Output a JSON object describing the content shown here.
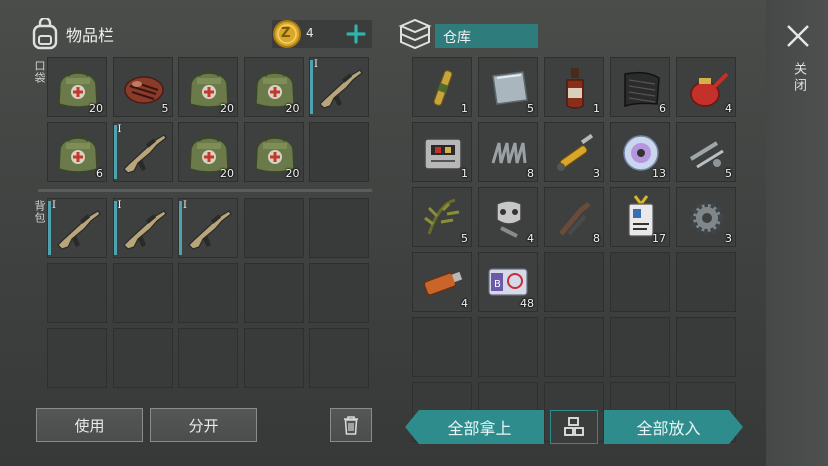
{
  "inventory": {
    "title": "物品栏",
    "pocket_label": "口袋",
    "backpack_label": "背包",
    "coins": {
      "count": "4",
      "symbol": "Z"
    },
    "pocket_slots": [
      {
        "item": "medkit-bag",
        "count": "20"
      },
      {
        "item": "steak",
        "count": "5"
      },
      {
        "item": "medkit-bag",
        "count": "20"
      },
      {
        "item": "medkit-bag",
        "count": "20"
      },
      {
        "item": "rifle",
        "tier": "I"
      },
      {
        "item": "medkit-bag",
        "count": "6"
      },
      {
        "item": "rifle",
        "tier": "I"
      },
      {
        "item": "medkit-bag",
        "count": "20"
      },
      {
        "item": "medkit-bag",
        "count": "20"
      },
      {
        "item": ""
      }
    ],
    "backpack_slots": [
      {
        "item": "rifle",
        "tier": "I"
      },
      {
        "item": "rifle",
        "tier": "I"
      },
      {
        "item": "rifle",
        "tier": "I"
      },
      {
        "item": ""
      },
      {
        "item": ""
      },
      {
        "item": ""
      },
      {
        "item": ""
      },
      {
        "item": ""
      },
      {
        "item": ""
      },
      {
        "item": ""
      },
      {
        "item": ""
      },
      {
        "item": ""
      },
      {
        "item": ""
      },
      {
        "item": ""
      },
      {
        "item": ""
      }
    ]
  },
  "storage": {
    "title": "仓库",
    "slots": [
      {
        "item": "ampoule",
        "count": "1"
      },
      {
        "item": "metal-plate",
        "count": "5"
      },
      {
        "item": "bottle",
        "count": "1"
      },
      {
        "item": "rubber-sheet",
        "count": "6"
      },
      {
        "item": "oil-can",
        "count": "4"
      },
      {
        "item": "electronic-board",
        "count": "1"
      },
      {
        "item": "spring",
        "count": "8"
      },
      {
        "item": "hydraulic-cylinder",
        "count": "3"
      },
      {
        "item": "cd-disc",
        "count": "13"
      },
      {
        "item": "bolts",
        "count": "5"
      },
      {
        "item": "plant",
        "count": "5"
      },
      {
        "item": "gas-mask-parts",
        "count": "4"
      },
      {
        "item": "pipes",
        "count": "8"
      },
      {
        "item": "id-card",
        "count": "17"
      },
      {
        "item": "gear",
        "count": "3"
      },
      {
        "item": "usb-drive",
        "count": "4"
      },
      {
        "item": "bio-keycard",
        "count": "48"
      },
      {
        "item": ""
      },
      {
        "item": ""
      },
      {
        "item": ""
      },
      {
        "item": ""
      },
      {
        "item": ""
      },
      {
        "item": ""
      },
      {
        "item": ""
      },
      {
        "item": ""
      },
      {
        "item": ""
      },
      {
        "item": ""
      },
      {
        "item": ""
      },
      {
        "item": ""
      },
      {
        "item": ""
      }
    ]
  },
  "buttons": {
    "use": "使用",
    "split": "分开",
    "take_all": "全部拿上",
    "put_all": "全部放入",
    "close": "关闭"
  },
  "colors": {
    "accent": "#2f8c8c",
    "durability": "#4fa3b0",
    "coin": "#d9a82a"
  }
}
